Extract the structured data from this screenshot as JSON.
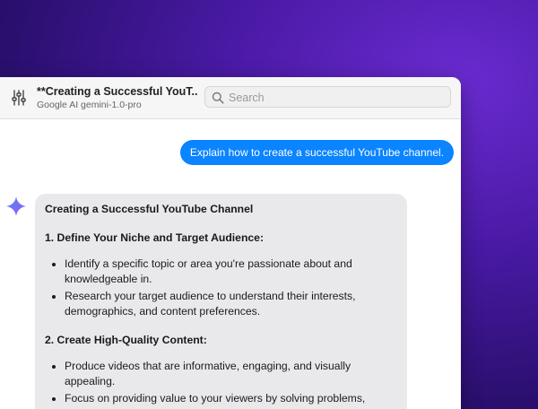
{
  "toolbar": {
    "title": "**Creating a Successful YouT...",
    "subtitle": "Google AI gemini-1.0-pro",
    "search_placeholder": "Search",
    "settings_icon": "sliders-icon",
    "search_icon": "magnifier-icon"
  },
  "conversation": {
    "user_message": "Explain how to create a successful YouTube channel.",
    "assistant_icon": "gemini-sparkle-icon",
    "assistant_message": {
      "heading": "Creating a Successful YouTube Channel",
      "sections": [
        {
          "title": "1. Define Your Niche and Target Audience:",
          "bullets": [
            "Identify a specific topic or area you're passionate about and knowledgeable in.",
            "Research your target audience to understand their interests, demographics, and content preferences."
          ]
        },
        {
          "title": "2. Create High-Quality Content:",
          "bullets": [
            "Produce videos that are informative, engaging, and visually appealing.",
            "Focus on providing value to your viewers by solving problems, sharing knowledge, or entertaining them."
          ]
        }
      ]
    }
  },
  "colors": {
    "user_bubble": "#0a84ff",
    "assistant_bubble": "#e9e9eb",
    "background": "#4a1aa6"
  }
}
